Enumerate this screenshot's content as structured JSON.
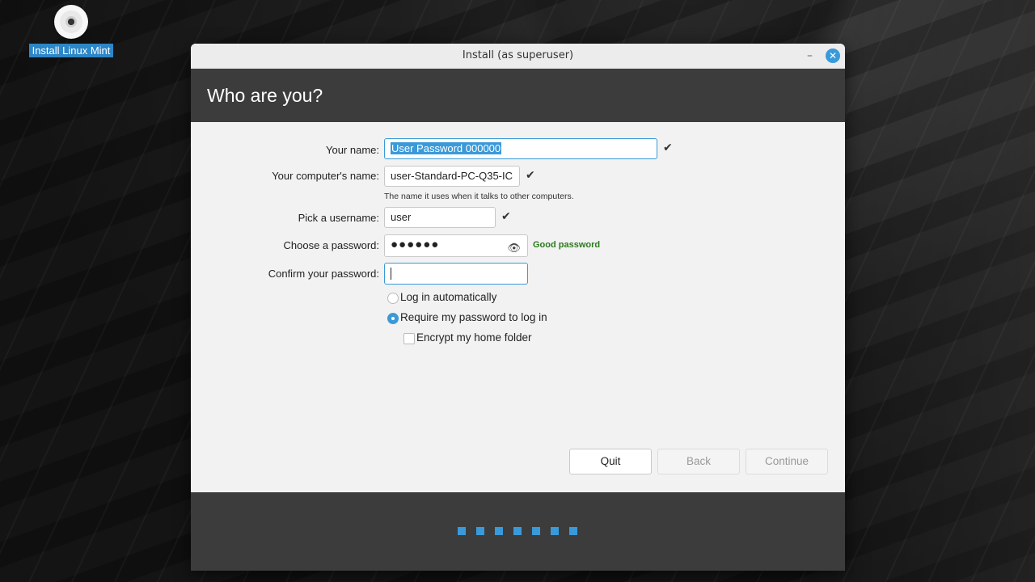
{
  "desktop": {
    "icon_label": "Install Linux Mint",
    "icon": "disc-icon"
  },
  "window": {
    "title": "Install (as superuser)",
    "minimize_glyph": "–",
    "close_glyph": "✕"
  },
  "page": {
    "heading": "Who are you?"
  },
  "form": {
    "name_label": "Your name:",
    "name_value": "User Password 000000",
    "computer_label": "Your computer's name:",
    "computer_value": "user-Standard-PC-Q35-IC",
    "computer_hint": "The name it uses when it talks to other computers.",
    "username_label": "Pick a username:",
    "username_value": "user",
    "password_label": "Choose a password:",
    "password_value": "●●●●●●",
    "password_strength": "Good password",
    "confirm_label": "Confirm your password:",
    "confirm_value": "",
    "check_glyph": "✔",
    "eye_glyph": "👁"
  },
  "options": {
    "auto_login": "Log in automatically",
    "require_password": "Require my password to log in",
    "selected": "require_password",
    "encrypt_home": "Encrypt my home folder",
    "encrypt_checked": false
  },
  "buttons": {
    "quit": "Quit",
    "back": "Back",
    "continue": "Continue"
  },
  "progress": {
    "steps": 7
  },
  "colors": {
    "accent": "#3a9ad9",
    "header_bg": "#3c3c3c",
    "good": "#2b7a1c"
  }
}
